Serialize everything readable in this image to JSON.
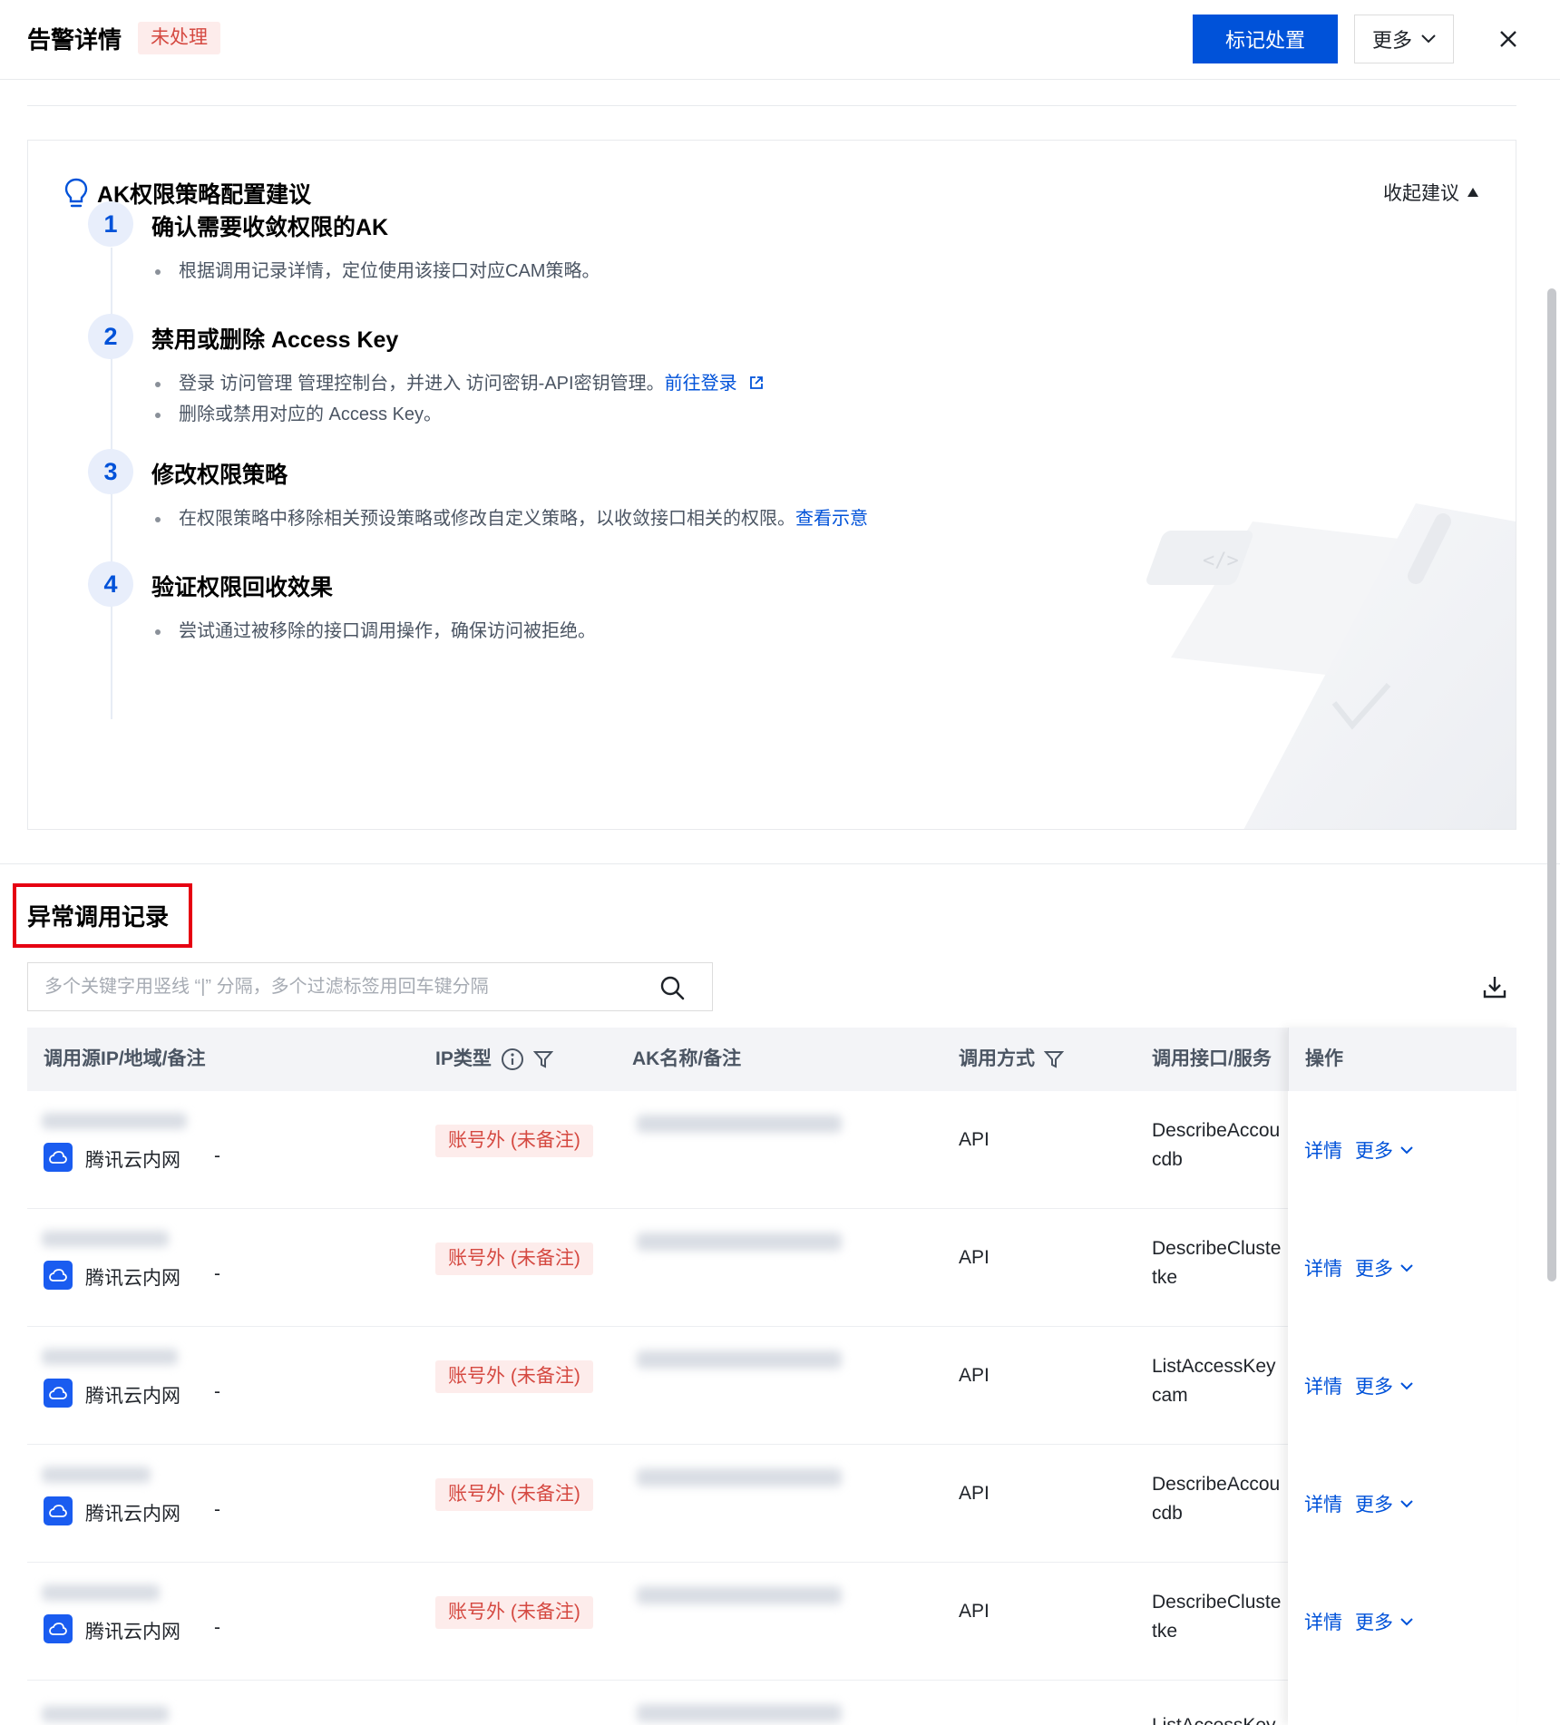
{
  "header": {
    "title": "告警详情",
    "status": "未处理",
    "primary_button": "标记处置",
    "more_button": "更多"
  },
  "advice": {
    "title": "AK权限策略配置建议",
    "collapse_label": "收起建议",
    "steps": [
      {
        "num": "1",
        "title": "确认需要收敛权限的AK",
        "items": [
          "根据调用记录详情，定位使用该接口对应CAM策略。"
        ]
      },
      {
        "num": "2",
        "title": "禁用或删除 Access Key",
        "item1_text": "登录 访问管理 管理控制台，并进入 访问密钥-API密钥管理。",
        "item1_link": "前往登录",
        "item2_text": "删除或禁用对应的 Access Key。"
      },
      {
        "num": "3",
        "title": "修改权限策略",
        "item1_text": "在权限策略中移除相关预设策略或修改自定义策略，以收敛接口相关的权限。",
        "item1_link": "查看示意"
      },
      {
        "num": "4",
        "title": "验证权限回收效果",
        "items": [
          "尝试通过被移除的接口调用操作，确保访问被拒绝。"
        ]
      }
    ]
  },
  "records": {
    "title": "异常调用记录",
    "search_placeholder": "多个关键字用竖线 “|” 分隔，多个过滤标签用回车键分隔",
    "columns": {
      "source": "调用源IP/地域/备注",
      "ip_type": "IP类型",
      "ak": "AK名称/备注",
      "method": "调用方式",
      "api": "调用接口/服务",
      "ops": "操作"
    },
    "rows": [
      {
        "network": "腾讯云内网",
        "remark": "-",
        "ip_type": "账号外 (未备注)",
        "method": "API",
        "api": "DescribeAccou",
        "service": "cdb",
        "detail": "详情",
        "more": "更多"
      },
      {
        "network": "腾讯云内网",
        "remark": "-",
        "ip_type": "账号外 (未备注)",
        "method": "API",
        "api": "DescribeCluste",
        "service": "tke",
        "detail": "详情",
        "more": "更多"
      },
      {
        "network": "腾讯云内网",
        "remark": "-",
        "ip_type": "账号外 (未备注)",
        "method": "API",
        "api": "ListAccessKey",
        "service": "cam",
        "detail": "详情",
        "more": "更多"
      },
      {
        "network": "腾讯云内网",
        "remark": "-",
        "ip_type": "账号外 (未备注)",
        "method": "API",
        "api": "DescribeAccou",
        "service": "cdb",
        "detail": "详情",
        "more": "更多"
      },
      {
        "network": "腾讯云内网",
        "remark": "-",
        "ip_type": "账号外 (未备注)",
        "method": "API",
        "api": "DescribeCluste",
        "service": "tke",
        "detail": "详情",
        "more": "更多"
      }
    ],
    "partial_row_api": "ListAccessKey"
  },
  "colors": {
    "primary": "#0052d9",
    "danger_text": "#d54941",
    "danger_bg": "#fdeceb",
    "highlight_box": "#e60012"
  }
}
